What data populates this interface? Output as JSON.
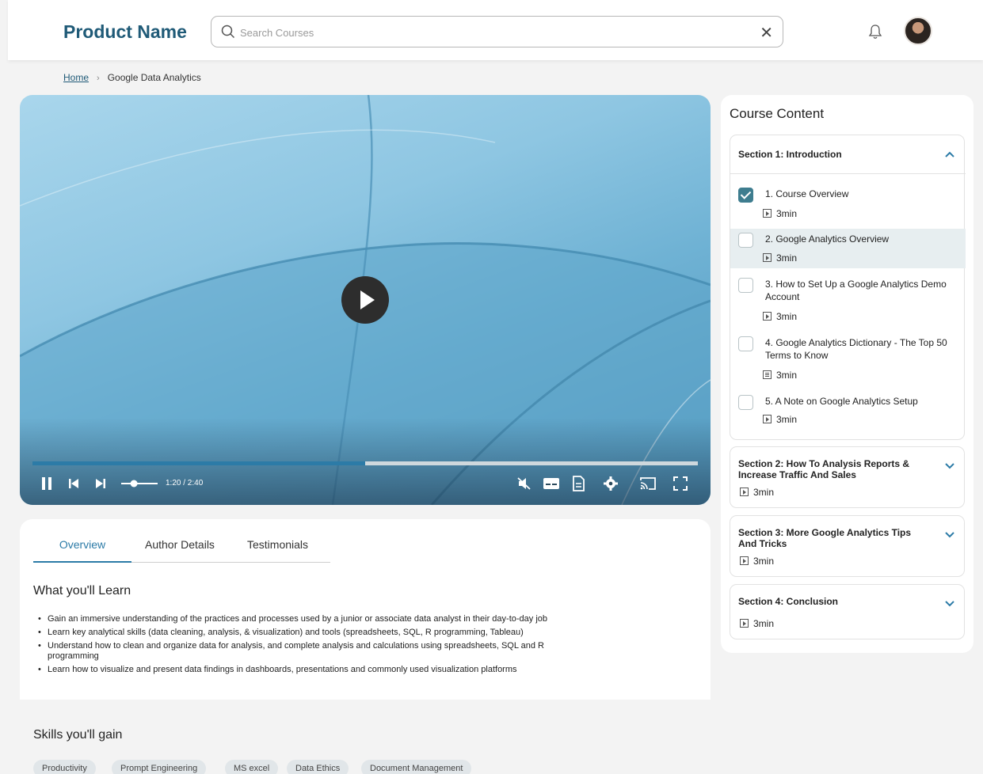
{
  "header": {
    "brand": "Product Name",
    "search": {
      "placeholder": "Search Courses",
      "value": ""
    }
  },
  "breadcrumb": {
    "home": "Home",
    "current": "Google Data Analytics"
  },
  "player": {
    "time": "1:20 / 2:40",
    "progress": 0.5,
    "volume": 0.35
  },
  "tabs": [
    {
      "label": "Overview",
      "active": true
    },
    {
      "label": "Author Details",
      "active": false
    },
    {
      "label": "Testimonials",
      "active": false
    }
  ],
  "learn": {
    "title": "What you'll Learn",
    "items": [
      "Gain an immersive understanding of the practices and processes used by a junior or associate data analyst in their day-to-day job",
      "Learn key analytical skills (data cleaning, analysis, & visualization) and tools (spreadsheets, SQL, R programming, Tableau)",
      "Understand how to clean and organize data for analysis, and complete analysis and calculations using spreadsheets, SQL and R programming",
      "Learn how to visualize and present data findings in dashboards, presentations and commonly used visualization platforms"
    ]
  },
  "skills": {
    "title": "Skills you'll gain",
    "items": [
      "Productivity",
      "Prompt Engineering",
      "MS excel",
      "Data Ethics",
      "Document Management"
    ]
  },
  "course": {
    "title": "Course Content",
    "sections": [
      {
        "title": "Section 1: Introduction",
        "expanded": true,
        "lessons": [
          {
            "title": "1. Course Overview",
            "duration": "3min",
            "type": "video",
            "completed": true
          },
          {
            "title": "2. Google Analytics Overview",
            "duration": "3min",
            "type": "video",
            "completed": false
          },
          {
            "title": "3. How to Set Up a Google Analytics Demo Account",
            "duration": "3min",
            "type": "video",
            "completed": false
          },
          {
            "title": "4. Google Analytics Dictionary - The Top 50 Terms to Know",
            "duration": "3min",
            "type": "document",
            "completed": false
          },
          {
            "title": "5. A Note on Google Analytics Setup",
            "duration": "3min",
            "type": "video",
            "completed": false
          }
        ]
      },
      {
        "title": "Section 2: How To Analysis Reports & Increase Traffic And Sales",
        "duration": "3min",
        "expanded": false
      },
      {
        "title": "Section 3: More Google Analytics Tips And Tricks",
        "duration": "3min",
        "expanded": false
      },
      {
        "title": "Section 4: Conclusion",
        "duration": "3min",
        "expanded": false
      }
    ]
  },
  "colors": {
    "brand": "#1f5a77",
    "accent": "#2c7ba7",
    "check": "#3e7d8f"
  }
}
